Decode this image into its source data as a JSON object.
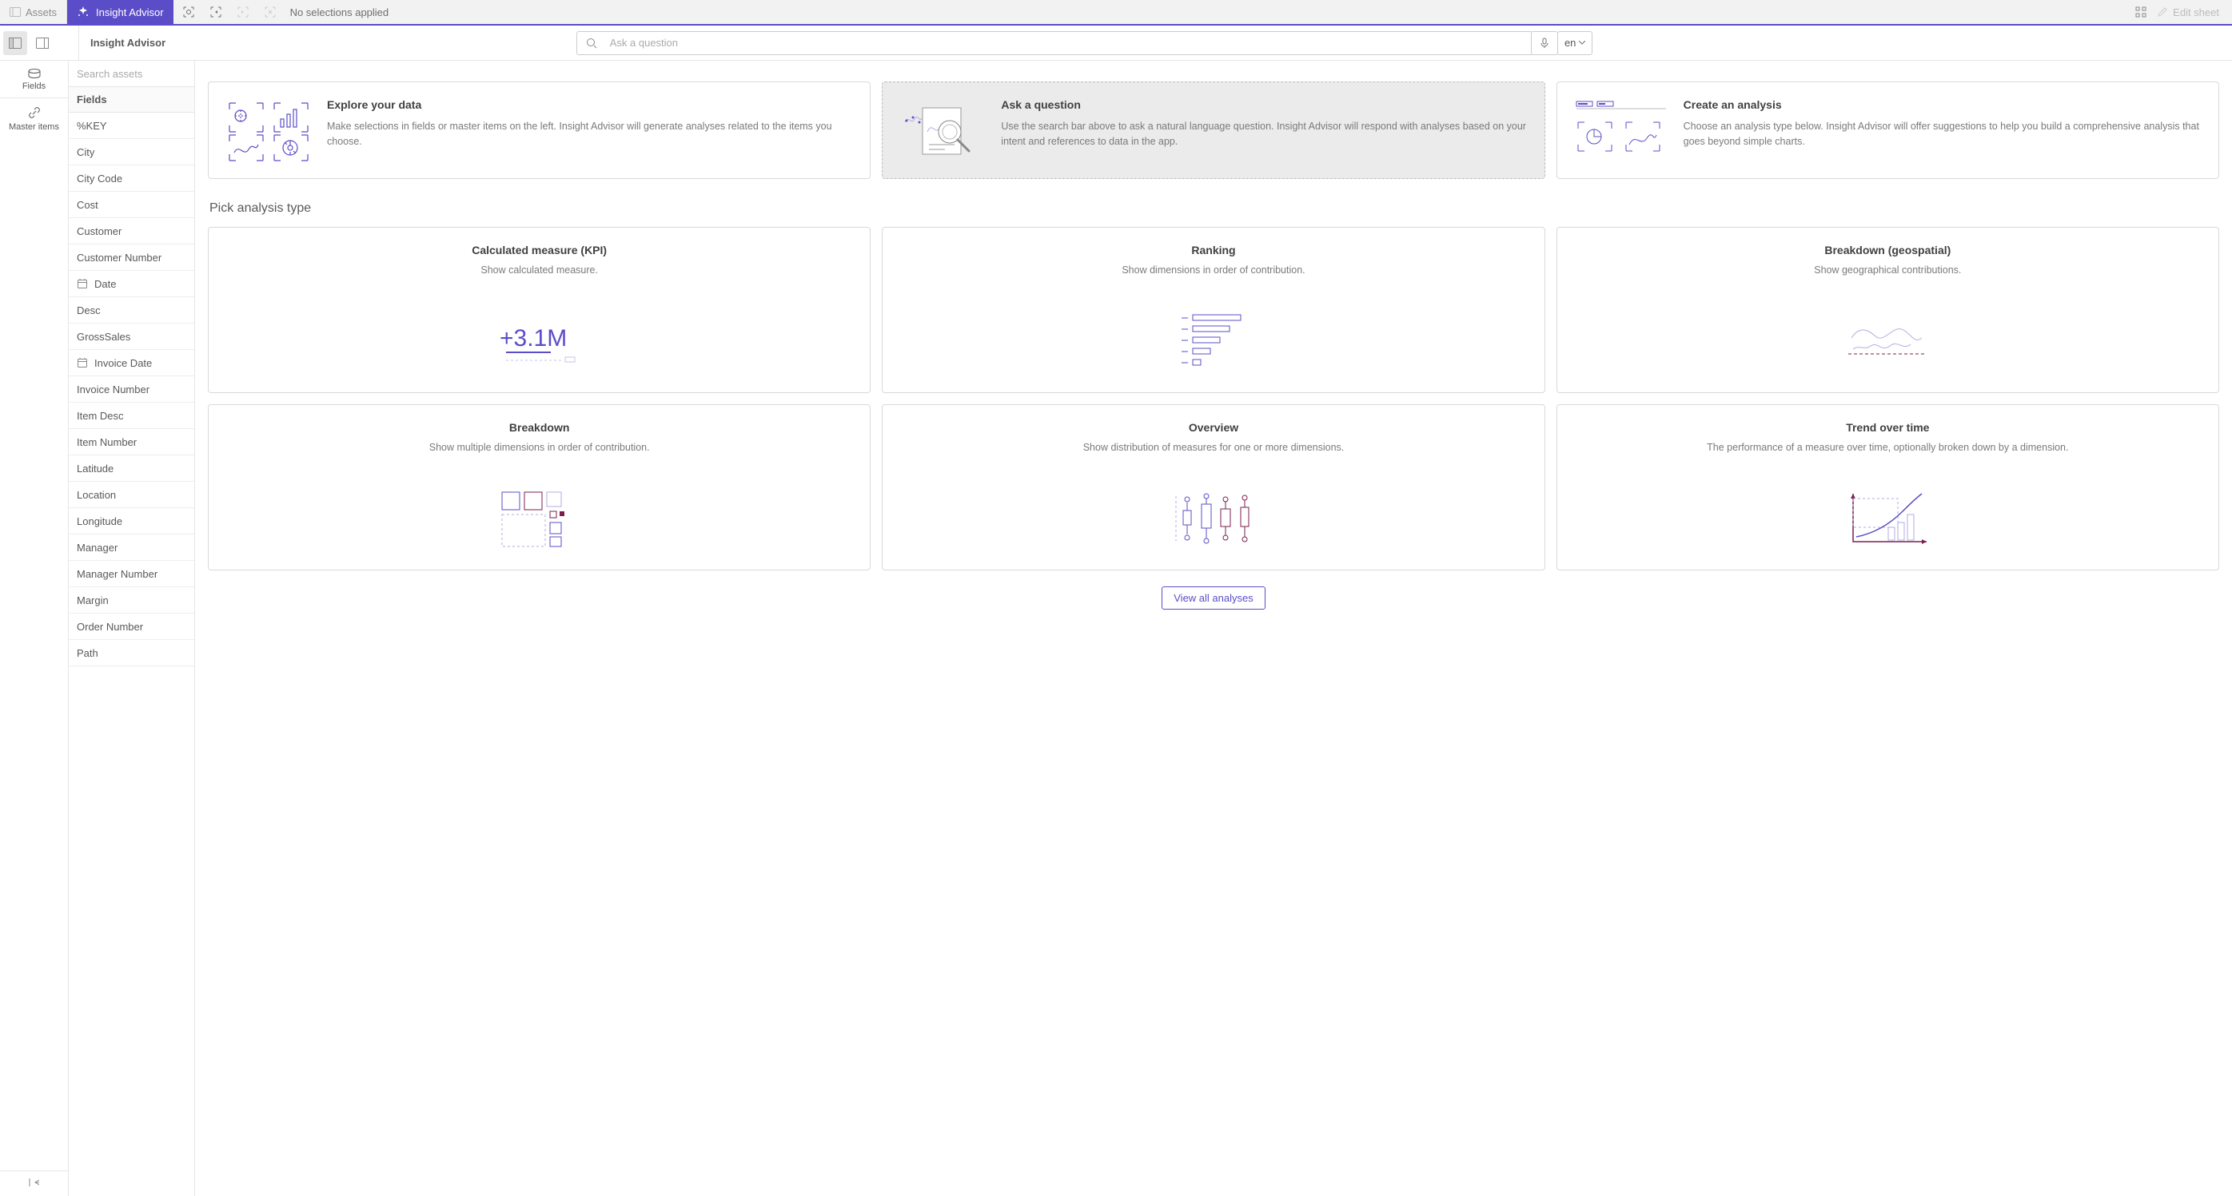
{
  "topbar": {
    "assets_label": "Assets",
    "advisor_label": "Insight Advisor",
    "no_selections": "No selections applied",
    "edit_sheet": "Edit sheet"
  },
  "secondary": {
    "title": "Insight Advisor",
    "search_placeholder": "Ask a question",
    "lang": "en"
  },
  "leftrail": {
    "fields": "Fields",
    "master_items": "Master items"
  },
  "assets": {
    "search_placeholder": "Search assets",
    "header": "Fields",
    "fields": [
      {
        "label": "%KEY",
        "date": false
      },
      {
        "label": "City",
        "date": false
      },
      {
        "label": "City Code",
        "date": false
      },
      {
        "label": "Cost",
        "date": false
      },
      {
        "label": "Customer",
        "date": false
      },
      {
        "label": "Customer Number",
        "date": false
      },
      {
        "label": "Date",
        "date": true
      },
      {
        "label": "Desc",
        "date": false
      },
      {
        "label": "GrossSales",
        "date": false
      },
      {
        "label": "Invoice Date",
        "date": true
      },
      {
        "label": "Invoice Number",
        "date": false
      },
      {
        "label": "Item Desc",
        "date": false
      },
      {
        "label": "Item Number",
        "date": false
      },
      {
        "label": "Latitude",
        "date": false
      },
      {
        "label": "Location",
        "date": false
      },
      {
        "label": "Longitude",
        "date": false
      },
      {
        "label": "Manager",
        "date": false
      },
      {
        "label": "Manager Number",
        "date": false
      },
      {
        "label": "Margin",
        "date": false
      },
      {
        "label": "Order Number",
        "date": false
      },
      {
        "label": "Path",
        "date": false
      }
    ]
  },
  "top_cards": [
    {
      "title": "Explore your data",
      "desc": "Make selections in fields or master items on the left. Insight Advisor will generate analyses related to the items you choose."
    },
    {
      "title": "Ask a question",
      "desc": "Use the search bar above to ask a natural language question. Insight Advisor will respond with analyses based on your intent and references to data in the app."
    },
    {
      "title": "Create an analysis",
      "desc": "Choose an analysis type below. Insight Advisor will offer suggestions to help you build a comprehensive analysis that goes beyond simple charts."
    }
  ],
  "pick_heading": "Pick analysis type",
  "analysis_cards": [
    {
      "title": "Calculated measure (KPI)",
      "desc": "Show calculated measure."
    },
    {
      "title": "Ranking",
      "desc": "Show dimensions in order of contribution."
    },
    {
      "title": "Breakdown (geospatial)",
      "desc": "Show geographical contributions."
    },
    {
      "title": "Breakdown",
      "desc": "Show multiple dimensions in order of contribution."
    },
    {
      "title": "Overview",
      "desc": "Show distribution of measures for one or more dimensions."
    },
    {
      "title": "Trend over time",
      "desc": "The performance of a measure over time, optionally broken down by a dimension."
    }
  ],
  "view_all": "View all analyses"
}
